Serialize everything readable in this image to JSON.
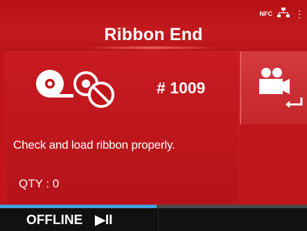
{
  "header": {
    "title": "Ribbon End",
    "nfc_label": "NFC"
  },
  "error": {
    "code": "# 1009",
    "message": "Check and load ribbon properly.",
    "qty": "QTY : 0",
    "icon": "ribbon-prohibited-icon"
  },
  "side_button": {
    "icon": "video-enter-icon"
  },
  "footer": {
    "status": "OFFLINE",
    "play_pause_icon": "▶II"
  },
  "colors": {
    "background": "#c1141a",
    "accent": "#3ea2df",
    "footer": "#111111"
  }
}
